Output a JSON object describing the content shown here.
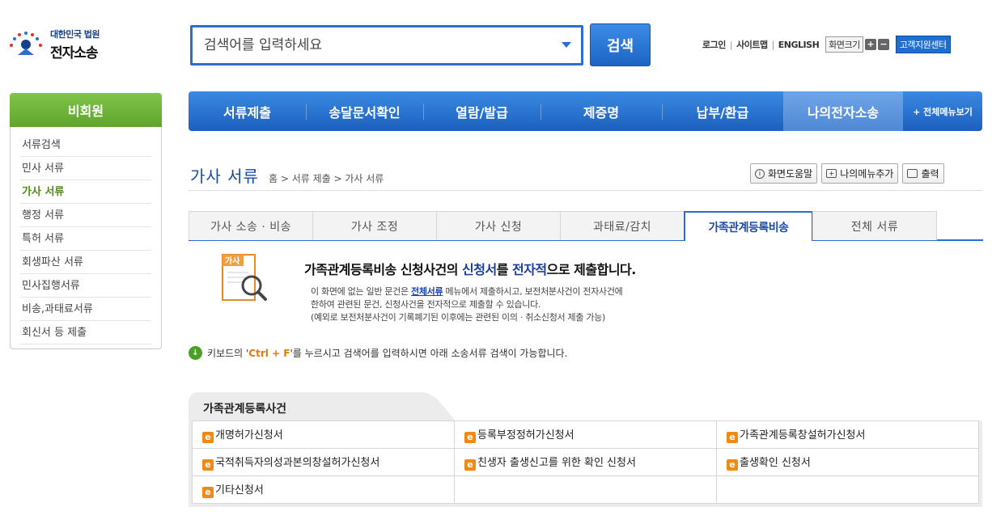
{
  "logo": {
    "line1": "대한민국 법원",
    "line2": "전자소송"
  },
  "search": {
    "placeholder": "검색어를 입력하세요",
    "button": "검색"
  },
  "util": {
    "login": "로그인",
    "sitemap": "사이트맵",
    "english": "ENGLISH",
    "zoom": "화면크기",
    "zoom_in": "+",
    "zoom_out": "−",
    "support": "고객지원센터"
  },
  "sidebar": {
    "header": "비회원",
    "items": [
      {
        "label": "서류검색"
      },
      {
        "label": "민사 서류"
      },
      {
        "label": "가사 서류"
      },
      {
        "label": "행정 서류"
      },
      {
        "label": "특허 서류"
      },
      {
        "label": "회생파산 서류"
      },
      {
        "label": "민사집행서류"
      },
      {
        "label": "비송,과태료서류"
      },
      {
        "label": "회신서 등 제출"
      }
    ]
  },
  "nav": {
    "items": [
      {
        "label": "서류제출"
      },
      {
        "label": "송달문서확인"
      },
      {
        "label": "열람/발급"
      },
      {
        "label": "제증명"
      },
      {
        "label": "납부/환급"
      },
      {
        "label": "나의전자소송"
      }
    ],
    "all": "+ 전체메뉴보기"
  },
  "page": {
    "title": "가사 서류",
    "breadcrumb": "홈 > 서류 제출 > 가사 서류"
  },
  "tools": {
    "help": "화면도움말",
    "add_menu": "나의메뉴추가",
    "print": "출력"
  },
  "tabs": [
    {
      "label": "가사 소송 · 비송"
    },
    {
      "label": "가사 조정"
    },
    {
      "label": "가사 신청"
    },
    {
      "label": "과태료/감치"
    },
    {
      "label": "가족관계등록비송"
    },
    {
      "label": "전체 서류"
    }
  ],
  "intro": {
    "icon_label": "가사",
    "head_a": "가족관계등록비송 신청사건의 ",
    "head_b": "신청서",
    "head_c": "를 ",
    "head_d": "전자적",
    "head_e": "으로 제출합니다.",
    "body1a": "이 화면에 없는 일반 문건은 ",
    "body1_link": "전체서류",
    "body1b": " 메뉴에서 제출하시고, 보전처분사건이 전자사건에",
    "body2": "한하여 관련된 문건, 신청사건을 전자적으로 제출할 수 있습니다.",
    "body3": "(예외로 보전처분사건이 기록폐기된 이후에는 관련된 이의 · 취소신청서 제출 가능)"
  },
  "hint": {
    "a": "키보드의 '",
    "key": "Ctrl + F",
    "b": "'를 누르시고 검색어를 입력하시면 아래 소송서류 검색이 가능합니다."
  },
  "section": {
    "title": "가족관계등록사건",
    "rows": [
      [
        "개명허가신청서",
        "등록부정정허가신청서",
        "가족관계등록창설허가신청서"
      ],
      [
        "국적취득자의성과본의창설허가신청서",
        "친생자 출생신고를 위한 확인 신청서",
        "출생확인 신청서"
      ],
      [
        "기타신청서",
        "",
        ""
      ]
    ]
  },
  "colors": {
    "primary": "#2a6fd0",
    "green": "#5fa42b",
    "title": "#1a4aa8"
  }
}
